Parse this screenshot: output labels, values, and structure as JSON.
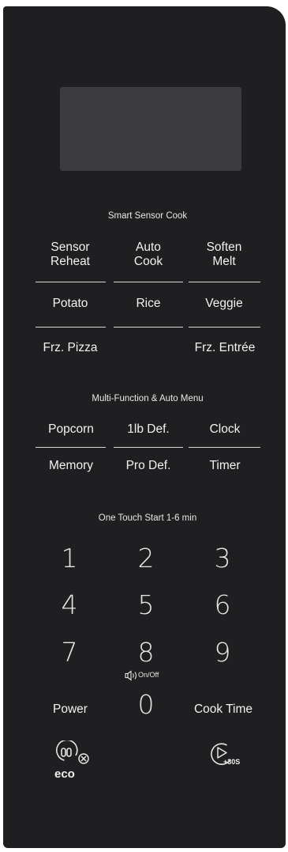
{
  "sections": {
    "smart_sensor": "Smart Sensor Cook",
    "multi_function": "Multi-Function & Auto Menu",
    "one_touch": "One Touch Start 1-6 min"
  },
  "sensor_buttons": {
    "sensor_reheat": "Sensor\nReheat",
    "auto_cook": "Auto\nCook",
    "soften_melt": "Soften\nMelt",
    "potato": "Potato",
    "rice": "Rice",
    "veggie": "Veggie",
    "frz_pizza": "Frz. Pizza",
    "frz_entree": "Frz. Entrée"
  },
  "menu_buttons": {
    "popcorn": "Popcorn",
    "one_lb_def": "1lb Def.",
    "clock": "Clock",
    "memory": "Memory",
    "pro_def": "Pro Def.",
    "timer": "Timer"
  },
  "keypad": {
    "d1": "1",
    "d2": "2",
    "d3": "3",
    "d4": "4",
    "d5": "5",
    "d6": "6",
    "d7": "7",
    "d8": "8",
    "d9": "9",
    "d0": "0",
    "power": "Power",
    "cook_time": "Cook Time",
    "sound_label": "On/Off"
  },
  "bottom": {
    "eco_label": "eco",
    "plus_30s_label": "+30S"
  },
  "icons": {
    "sound": "speaker-icon",
    "eco": "eco-icon",
    "start": "play-icon"
  }
}
